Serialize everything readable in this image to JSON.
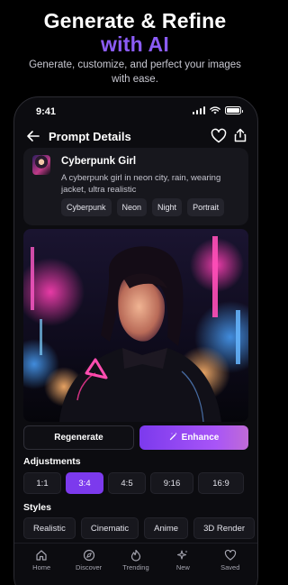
{
  "hero": {
    "title_line1": "Generate & Refine",
    "title_line2": "with AI",
    "subtitle": "Generate, customize, and perfect your images with ease."
  },
  "status": {
    "time": "9:41"
  },
  "header": {
    "title": "Prompt Details"
  },
  "prompt": {
    "title": "Cyberpunk Girl",
    "description": "A cyberpunk girl in neon city, rain, wearing jacket, ultra realistic",
    "tags": [
      "Cyberpunk",
      "Neon",
      "Night",
      "Portrait"
    ]
  },
  "actions": {
    "regenerate": "Regenerate",
    "enhance": "Enhance"
  },
  "adjustments": {
    "label": "Adjustments",
    "ratios": [
      "1:1",
      "3:4",
      "4:5",
      "9:16",
      "16:9"
    ],
    "selected": "3:4"
  },
  "styles": {
    "label": "Styles",
    "items": [
      "Realistic",
      "Cinematic",
      "Anime",
      "3D Render"
    ]
  },
  "tabbar": {
    "items": [
      {
        "label": "Home",
        "icon": "home-icon"
      },
      {
        "label": "Discover",
        "icon": "compass-icon"
      },
      {
        "label": "Trending",
        "icon": "flame-icon"
      },
      {
        "label": "New",
        "icon": "sparkle-icon"
      },
      {
        "label": "Saved",
        "icon": "heart-icon"
      }
    ]
  },
  "colors": {
    "accent": "#8b5cf6",
    "background": "#000000",
    "card": "#17171d"
  }
}
